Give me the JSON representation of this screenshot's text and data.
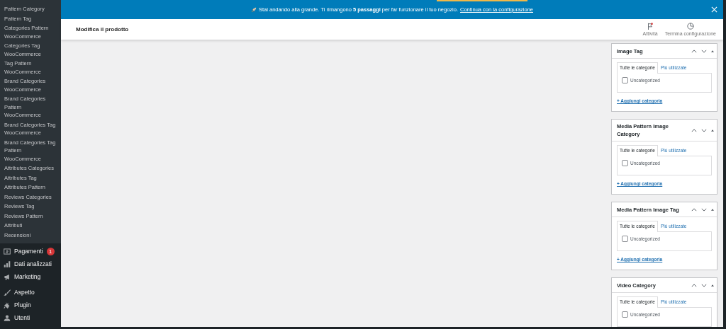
{
  "sidebar": {
    "submenu": [
      "Pattern Category",
      "Pattern Tag",
      "Categories Pattern WooCommerce",
      "Categories Tag WooCommerce",
      "Tag Pattern WooCommerce",
      "Brand Categories WooCommerce",
      "Brand Categories Pattern WooCommerce",
      "Brand Categories Tag WooCommerce",
      "Brand Categories Tag Pattern WooCommerce",
      "Attributes Categories",
      "Attributes Tag",
      "Attributes Pattern",
      "Reviews Categories",
      "Reviews Tag",
      "Reviews Pattern",
      "Attributi",
      "Recensioni"
    ],
    "menu": [
      {
        "kind": "payments",
        "label": "Pagamenti",
        "badge": "1"
      },
      {
        "kind": "analytics",
        "label": "Dati analizzati"
      },
      {
        "kind": "marketing",
        "label": "Marketing"
      },
      {
        "kind": "appearance",
        "label": "Aspetto"
      },
      {
        "kind": "plugin",
        "label": "Plugin"
      },
      {
        "kind": "users",
        "label": "Utenti"
      }
    ]
  },
  "notice": {
    "text": "Stai andando alla grande. Ti rimangono **5 passaggi** per far funzionare il tuo negozio.",
    "link": "Continua con la configurazione"
  },
  "header": {
    "title": "Modifica il prodotto",
    "actions": [
      {
        "kind": "activity",
        "label": "Attività"
      },
      {
        "kind": "setup",
        "label": "Termina configurazione"
      }
    ]
  },
  "panels": [
    {
      "title": "Image Tag",
      "tabs": [
        {
          "label": "Tutte le categorie",
          "selected": true
        },
        {
          "label": "Più utilizzate",
          "selected": false
        }
      ],
      "items": [
        {
          "label": "Uncategorized",
          "checked": false
        }
      ],
      "add_link": "+ Aggiungi categoria"
    },
    {
      "title": "Media Pattern Image Category",
      "tabs": [
        {
          "label": "Tutte le categorie",
          "selected": true
        },
        {
          "label": "Più utilizzate",
          "selected": false
        }
      ],
      "items": [
        {
          "label": "Uncategorized",
          "checked": false
        }
      ],
      "add_link": "+ Aggiungi categoria"
    },
    {
      "title": "Media Pattern Image Tag",
      "tabs": [
        {
          "label": "Tutte le categorie",
          "selected": true
        },
        {
          "label": "Più utilizzate",
          "selected": false
        }
      ],
      "items": [
        {
          "label": "Uncategorized",
          "checked": false
        }
      ],
      "add_link": "+ Aggiungi categoria"
    },
    {
      "title": "Video Category",
      "tabs": [
        {
          "label": "Tutte le categorie",
          "selected": true
        },
        {
          "label": "Più utilizzate",
          "selected": false
        }
      ],
      "items": [
        {
          "label": "Uncategorized",
          "checked": false
        }
      ]
    }
  ]
}
